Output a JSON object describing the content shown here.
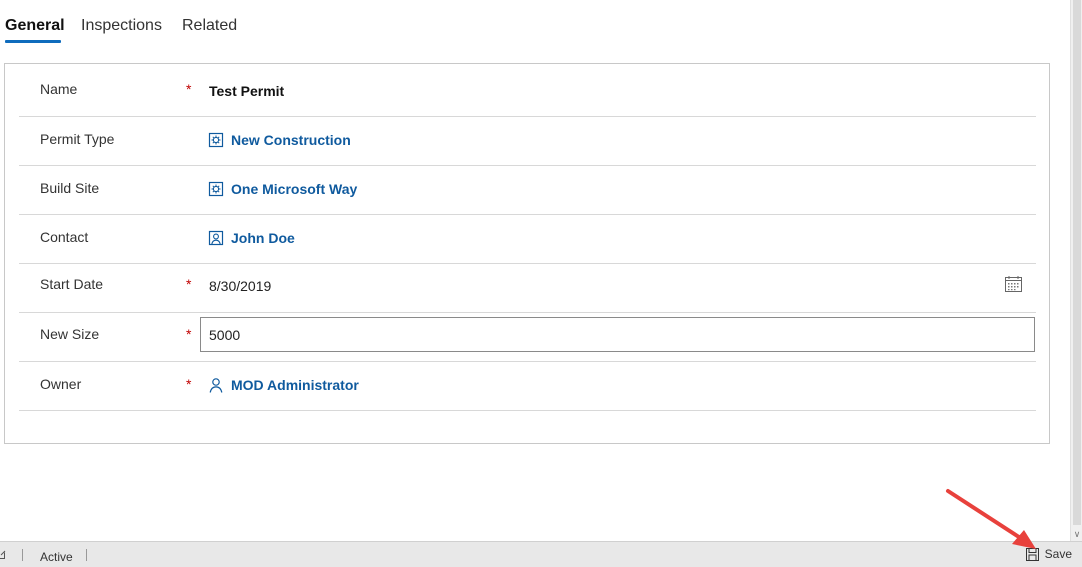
{
  "tabs": [
    {
      "label": "General",
      "active": true
    },
    {
      "label": "Inspections",
      "active": false
    },
    {
      "label": "Related",
      "active": false
    }
  ],
  "form": {
    "required_mark": "*",
    "fields": {
      "name": {
        "label": "Name",
        "value": "Test Permit",
        "required": true
      },
      "permit_type": {
        "label": "Permit Type",
        "value": "New Construction",
        "icon": "entity-record-icon"
      },
      "build_site": {
        "label": "Build Site",
        "value": "One Microsoft Way",
        "icon": "entity-record-icon"
      },
      "contact": {
        "label": "Contact",
        "value": "John Doe",
        "icon": "contact-card-icon"
      },
      "start_date": {
        "label": "Start Date",
        "value": "8/30/2019",
        "required": true,
        "icon": "calendar-icon"
      },
      "new_size": {
        "label": "New Size",
        "value": "5000",
        "required": true
      },
      "owner": {
        "label": "Owner",
        "value": "MOD Administrator",
        "required": true,
        "icon": "person-icon"
      }
    }
  },
  "statusbar": {
    "status": "Active",
    "save_label": "Save"
  },
  "colors": {
    "accent": "#0f6cbd",
    "lookup_link": "#0f5a9e",
    "required": "#c00000",
    "annotation_arrow": "#e8413c"
  }
}
